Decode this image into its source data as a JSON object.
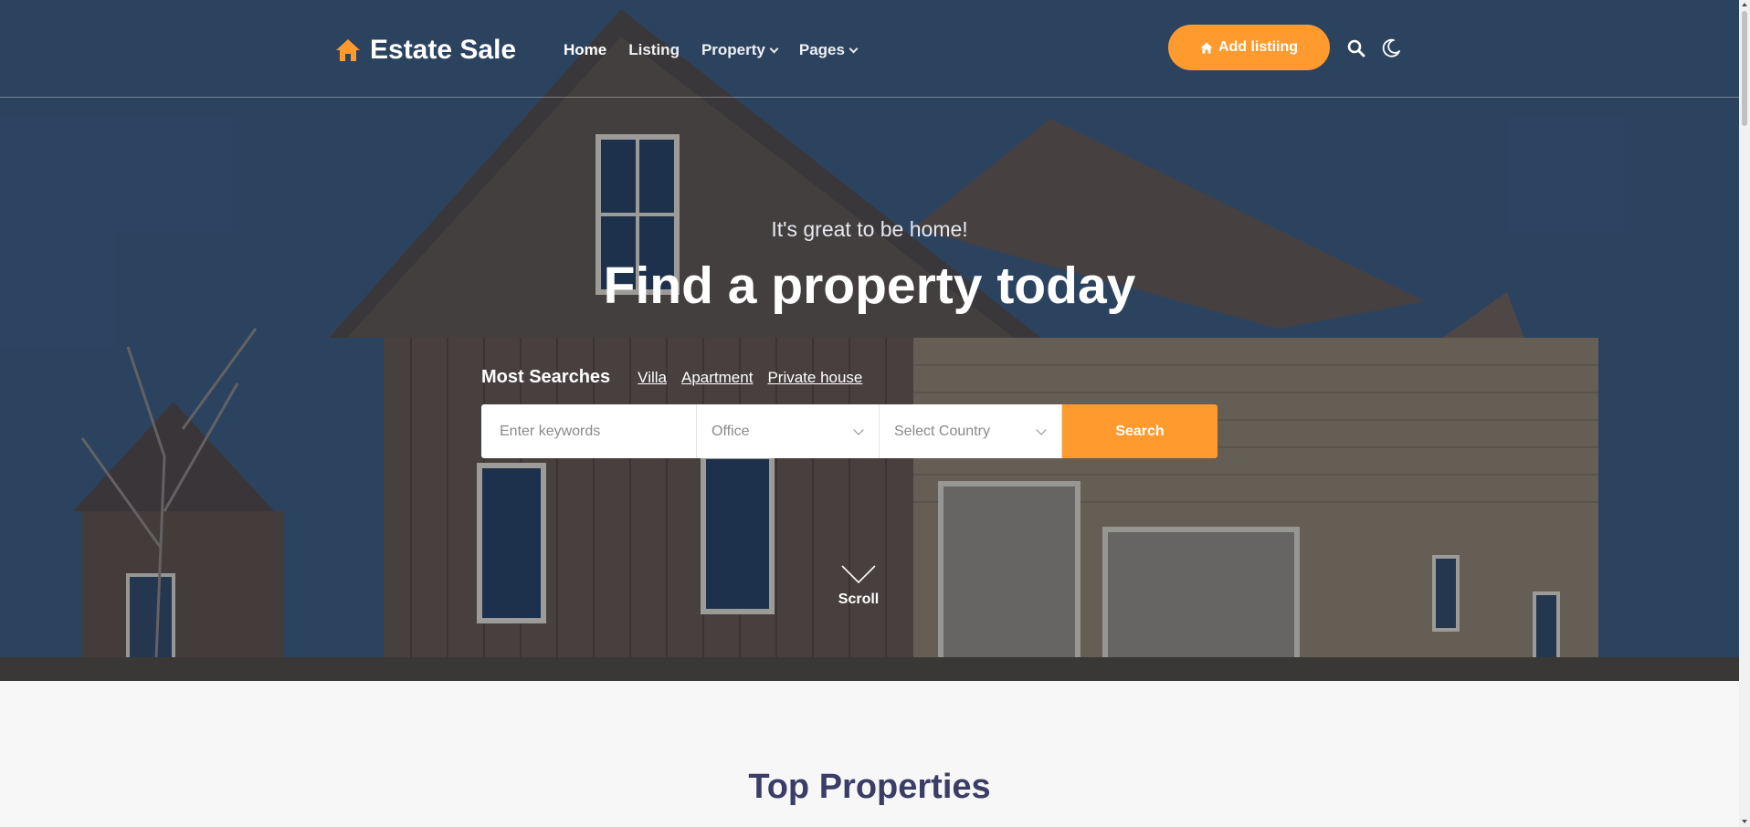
{
  "header": {
    "logo_text": "Estate Sale",
    "nav": [
      {
        "label": "Home"
      },
      {
        "label": "Listing"
      },
      {
        "label": "Property"
      },
      {
        "label": "Pages"
      }
    ],
    "add_listing_label": "Add listiing"
  },
  "hero": {
    "tagline": "It's great to be home!",
    "headline": "Find a property today",
    "most_searches": {
      "label": "Most Searches",
      "links": [
        "Villa",
        "Apartment",
        "Private house"
      ]
    },
    "search": {
      "keywords_placeholder": "Enter keywords",
      "type_value": "Office",
      "country_value": "Select Country",
      "button_label": "Search"
    },
    "scroll_label": "Scroll"
  },
  "section": {
    "title": "Top Properties"
  },
  "colors": {
    "accent": "#ff9a2f",
    "title": "#3b3d66"
  },
  "icons": [
    "home-icon",
    "search-icon",
    "moon-icon",
    "chevron-down-icon"
  ]
}
